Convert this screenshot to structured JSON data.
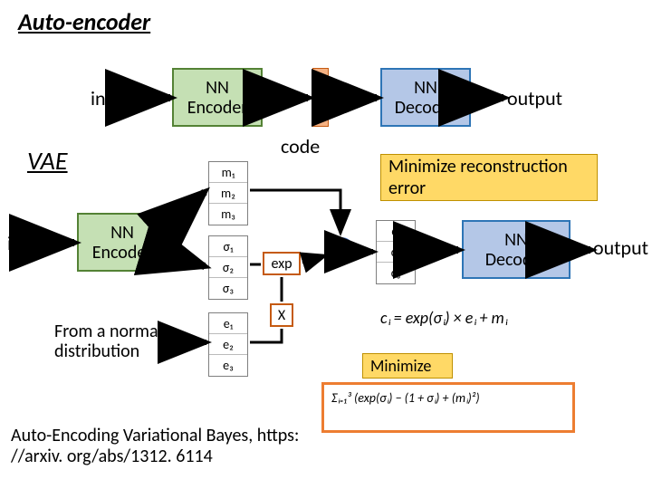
{
  "title": "Auto-encoder",
  "section_vae": "VAE",
  "labels": {
    "input_top": "input",
    "output_top": "output",
    "input_left": "input",
    "output_right": "output",
    "code": "code",
    "from_normal": "From a normal distribution",
    "minimize": "Minimize"
  },
  "blocks": {
    "nn_encoder": "NN\nEncoder",
    "nn_decoder": "NN\nDecoder"
  },
  "annotations": {
    "min_recon": "Minimize reconstruction error"
  },
  "vars": {
    "m": [
      "m₁",
      "m₂",
      "m₃"
    ],
    "sigma": [
      "σ₁",
      "σ₂",
      "σ₃"
    ],
    "e": [
      "e₁",
      "e₂",
      "e₃"
    ],
    "c": [
      "c₁",
      "c₂",
      "c₃"
    ]
  },
  "ops": {
    "exp": "exp",
    "times": "X",
    "plus": "+"
  },
  "equations": {
    "ci": "cᵢ = exp(σᵢ) × eᵢ + mᵢ",
    "loss": "Σᵢ₌₁³ (exp(σᵢ) − (1 + σᵢ) + (mᵢ)²)"
  },
  "citation": "Auto-Encoding Variational Bayes, https: //arxiv. org/abs/1312. 6114"
}
